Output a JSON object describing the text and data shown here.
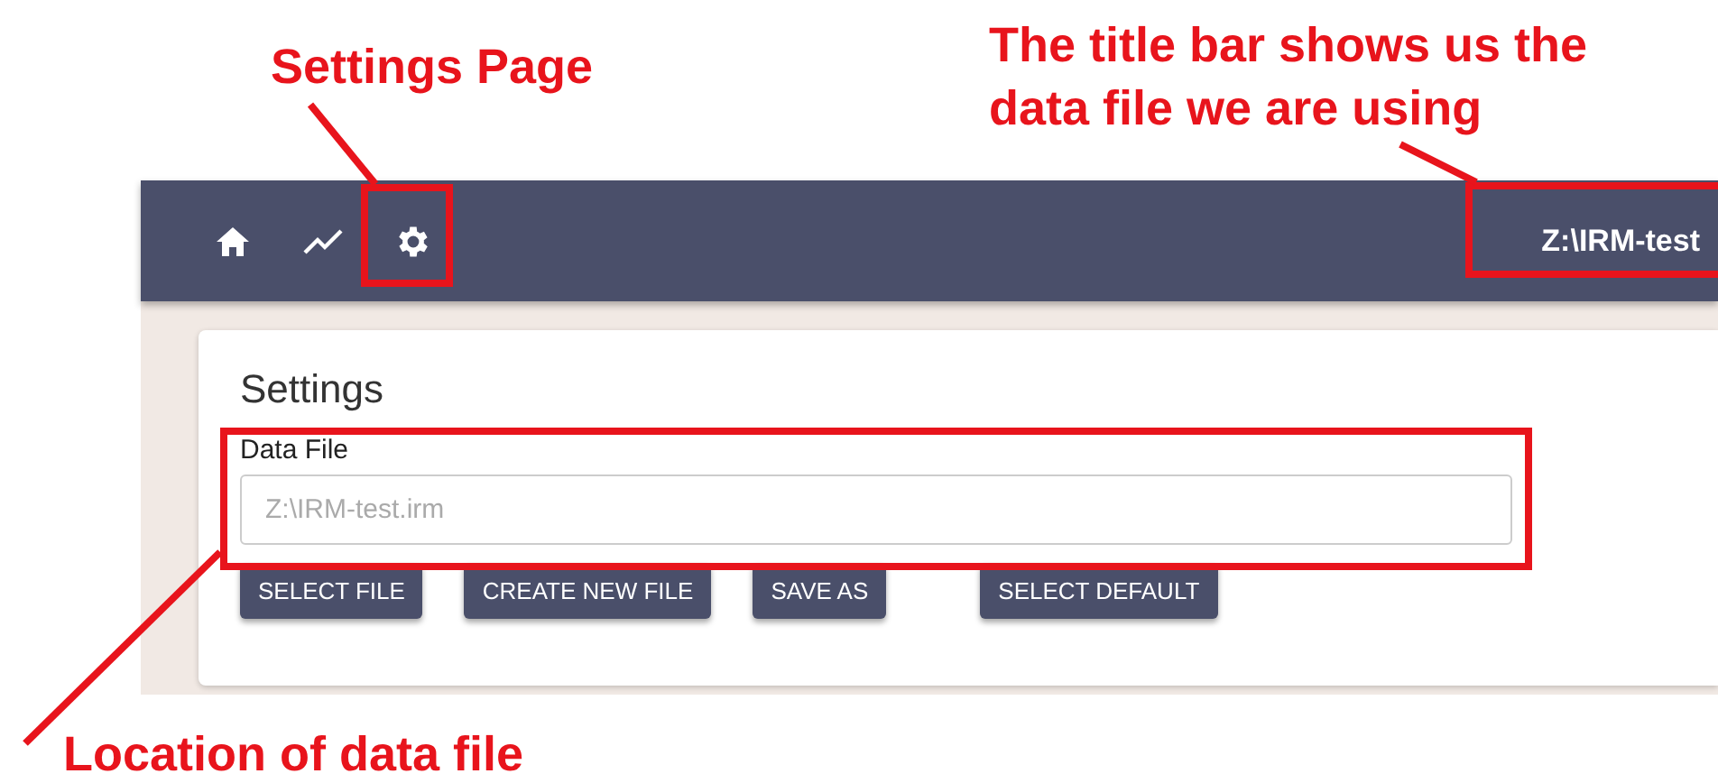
{
  "app_bar": {
    "nav_icons": [
      {
        "kind": "home"
      },
      {
        "kind": "chart"
      },
      {
        "kind": "settings"
      }
    ],
    "title": "Z:\\IRM-test"
  },
  "settings": {
    "heading": "Settings",
    "data_file": {
      "label": "Data File",
      "placeholder": "Z:\\IRM-test.irm"
    },
    "buttons": [
      "SELECT FILE",
      "CREATE NEW FILE",
      "SAVE AS",
      "SELECT DEFAULT"
    ]
  },
  "annotations": [
    {
      "kind": "settings",
      "lines": [
        "Settings Page"
      ]
    },
    {
      "kind": "title",
      "lines": [
        "The title bar shows us the",
        "data file we are using"
      ]
    },
    {
      "kind": "location",
      "lines": [
        "Location of data file"
      ]
    }
  ]
}
